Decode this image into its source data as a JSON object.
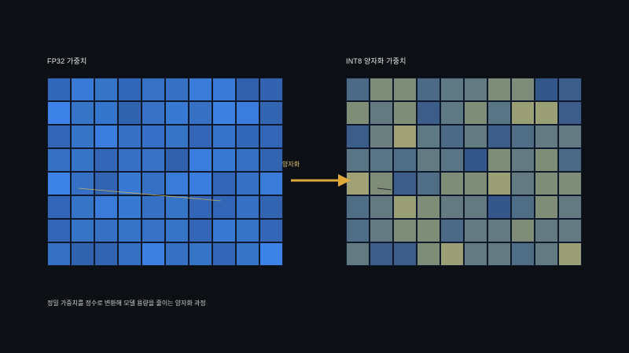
{
  "left_panel": {
    "title": "FP32 가중치"
  },
  "right_panel": {
    "title": "INT8 양자화 가중치"
  },
  "arrow": {
    "label": "양자화"
  },
  "caption": "정밀 가중치를 정수로 변환해 모델 용량을 줄이는 양자화 과정",
  "colors": {
    "background": "#0c0f14",
    "arrow": "#e0a93a",
    "trace": "#d9b45a"
  },
  "fp32_grid": [
    [
      "#3367b8",
      "#3a7ad6",
      "#3674c8",
      "#3368b9",
      "#3671c6",
      "#3570c4",
      "#3a7bd8",
      "#3a7ad6",
      "#325fac",
      "#3262b0"
    ],
    [
      "#3d82e6",
      "#3674c8",
      "#3675cc",
      "#3163ae",
      "#3671c6",
      "#3879d2",
      "#3570c4",
      "#3c80e2",
      "#3b7ddc",
      "#3264b2"
    ],
    [
      "#3366b6",
      "#3674c8",
      "#3b7ddc",
      "#3570c4",
      "#3670c6",
      "#3674c8",
      "#3366b6",
      "#3672c8",
      "#3368b9",
      "#3366b6"
    ],
    [
      "#3570c4",
      "#3674c8",
      "#3366b6",
      "#3570c4",
      "#3671c6",
      "#3161ad",
      "#3b7ddc",
      "#3879d2",
      "#3570c4",
      "#3264b2"
    ],
    [
      "#3d82e6",
      "#3570c4",
      "#3264b2",
      "#3879d2",
      "#3570c4",
      "#3a7bd8",
      "#3b7ddc",
      "#3366b6",
      "#3570c4",
      "#3a7bd8"
    ],
    [
      "#3366b6",
      "#3674c8",
      "#3a7bd8",
      "#3879d2",
      "#3570c4",
      "#3674c8",
      "#3366b6",
      "#3366b6",
      "#3570c4",
      "#3264b2"
    ],
    [
      "#3366b6",
      "#3674c8",
      "#3570c4",
      "#3674c8",
      "#3671c6",
      "#3674c8",
      "#3366b6",
      "#3879d2",
      "#3674c8",
      "#3366b6"
    ],
    [
      "#3570c4",
      "#3162ae",
      "#3264b2",
      "#3570c4",
      "#3c80e2",
      "#3570c4",
      "#3674c8",
      "#3366b6",
      "#3674c8",
      "#3d82e6"
    ]
  ],
  "int8_grid": [
    [
      "#4a6a86",
      "#7f8c77",
      "#7c8c78",
      "#4a6a86",
      "#5f7982",
      "#627a80",
      "#7f8c77",
      "#7c8c78",
      "#34578a",
      "#3b5d88"
    ],
    [
      "#7f8c77",
      "#627a80",
      "#7f8c77",
      "#3b5d88",
      "#5f7982",
      "#7f8c77",
      "#5a7686",
      "#9a9f75",
      "#9a9f75",
      "#3b5d88"
    ],
    [
      "#3b5d88",
      "#6a7f7e",
      "#a0a275",
      "#5f7982",
      "#4a6a86",
      "#627a80",
      "#3b5d88",
      "#4f6e86",
      "#627a80",
      "#627a80"
    ],
    [
      "#5a7686",
      "#5a7686",
      "#4f6e86",
      "#627a80",
      "#5a7686",
      "#34578a",
      "#7f8c77",
      "#627a80",
      "#7f8c77",
      "#4a6a86"
    ],
    [
      "#a0a275",
      "#7f8c77",
      "#3b5d88",
      "#4f6e86",
      "#7f8c77",
      "#7f8c77",
      "#9a9f75",
      "#627a80",
      "#7f8c77",
      "#7f8c77"
    ],
    [
      "#4f6e86",
      "#627a80",
      "#9a9f75",
      "#7f8c77",
      "#627a80",
      "#627a80",
      "#34578a",
      "#4f6e86",
      "#7f8c77",
      "#627a80"
    ],
    [
      "#4f6e86",
      "#627a80",
      "#7f8c77",
      "#7f8c77",
      "#4a6a86",
      "#627a80",
      "#627a80",
      "#7f8c77",
      "#627a80",
      "#627a80"
    ],
    [
      "#627a80",
      "#3b5d88",
      "#3b5d88",
      "#7f8c77",
      "#9a9f75",
      "#627a80",
      "#627a80",
      "#4f6e86",
      "#627a80",
      "#9a9f75"
    ]
  ]
}
